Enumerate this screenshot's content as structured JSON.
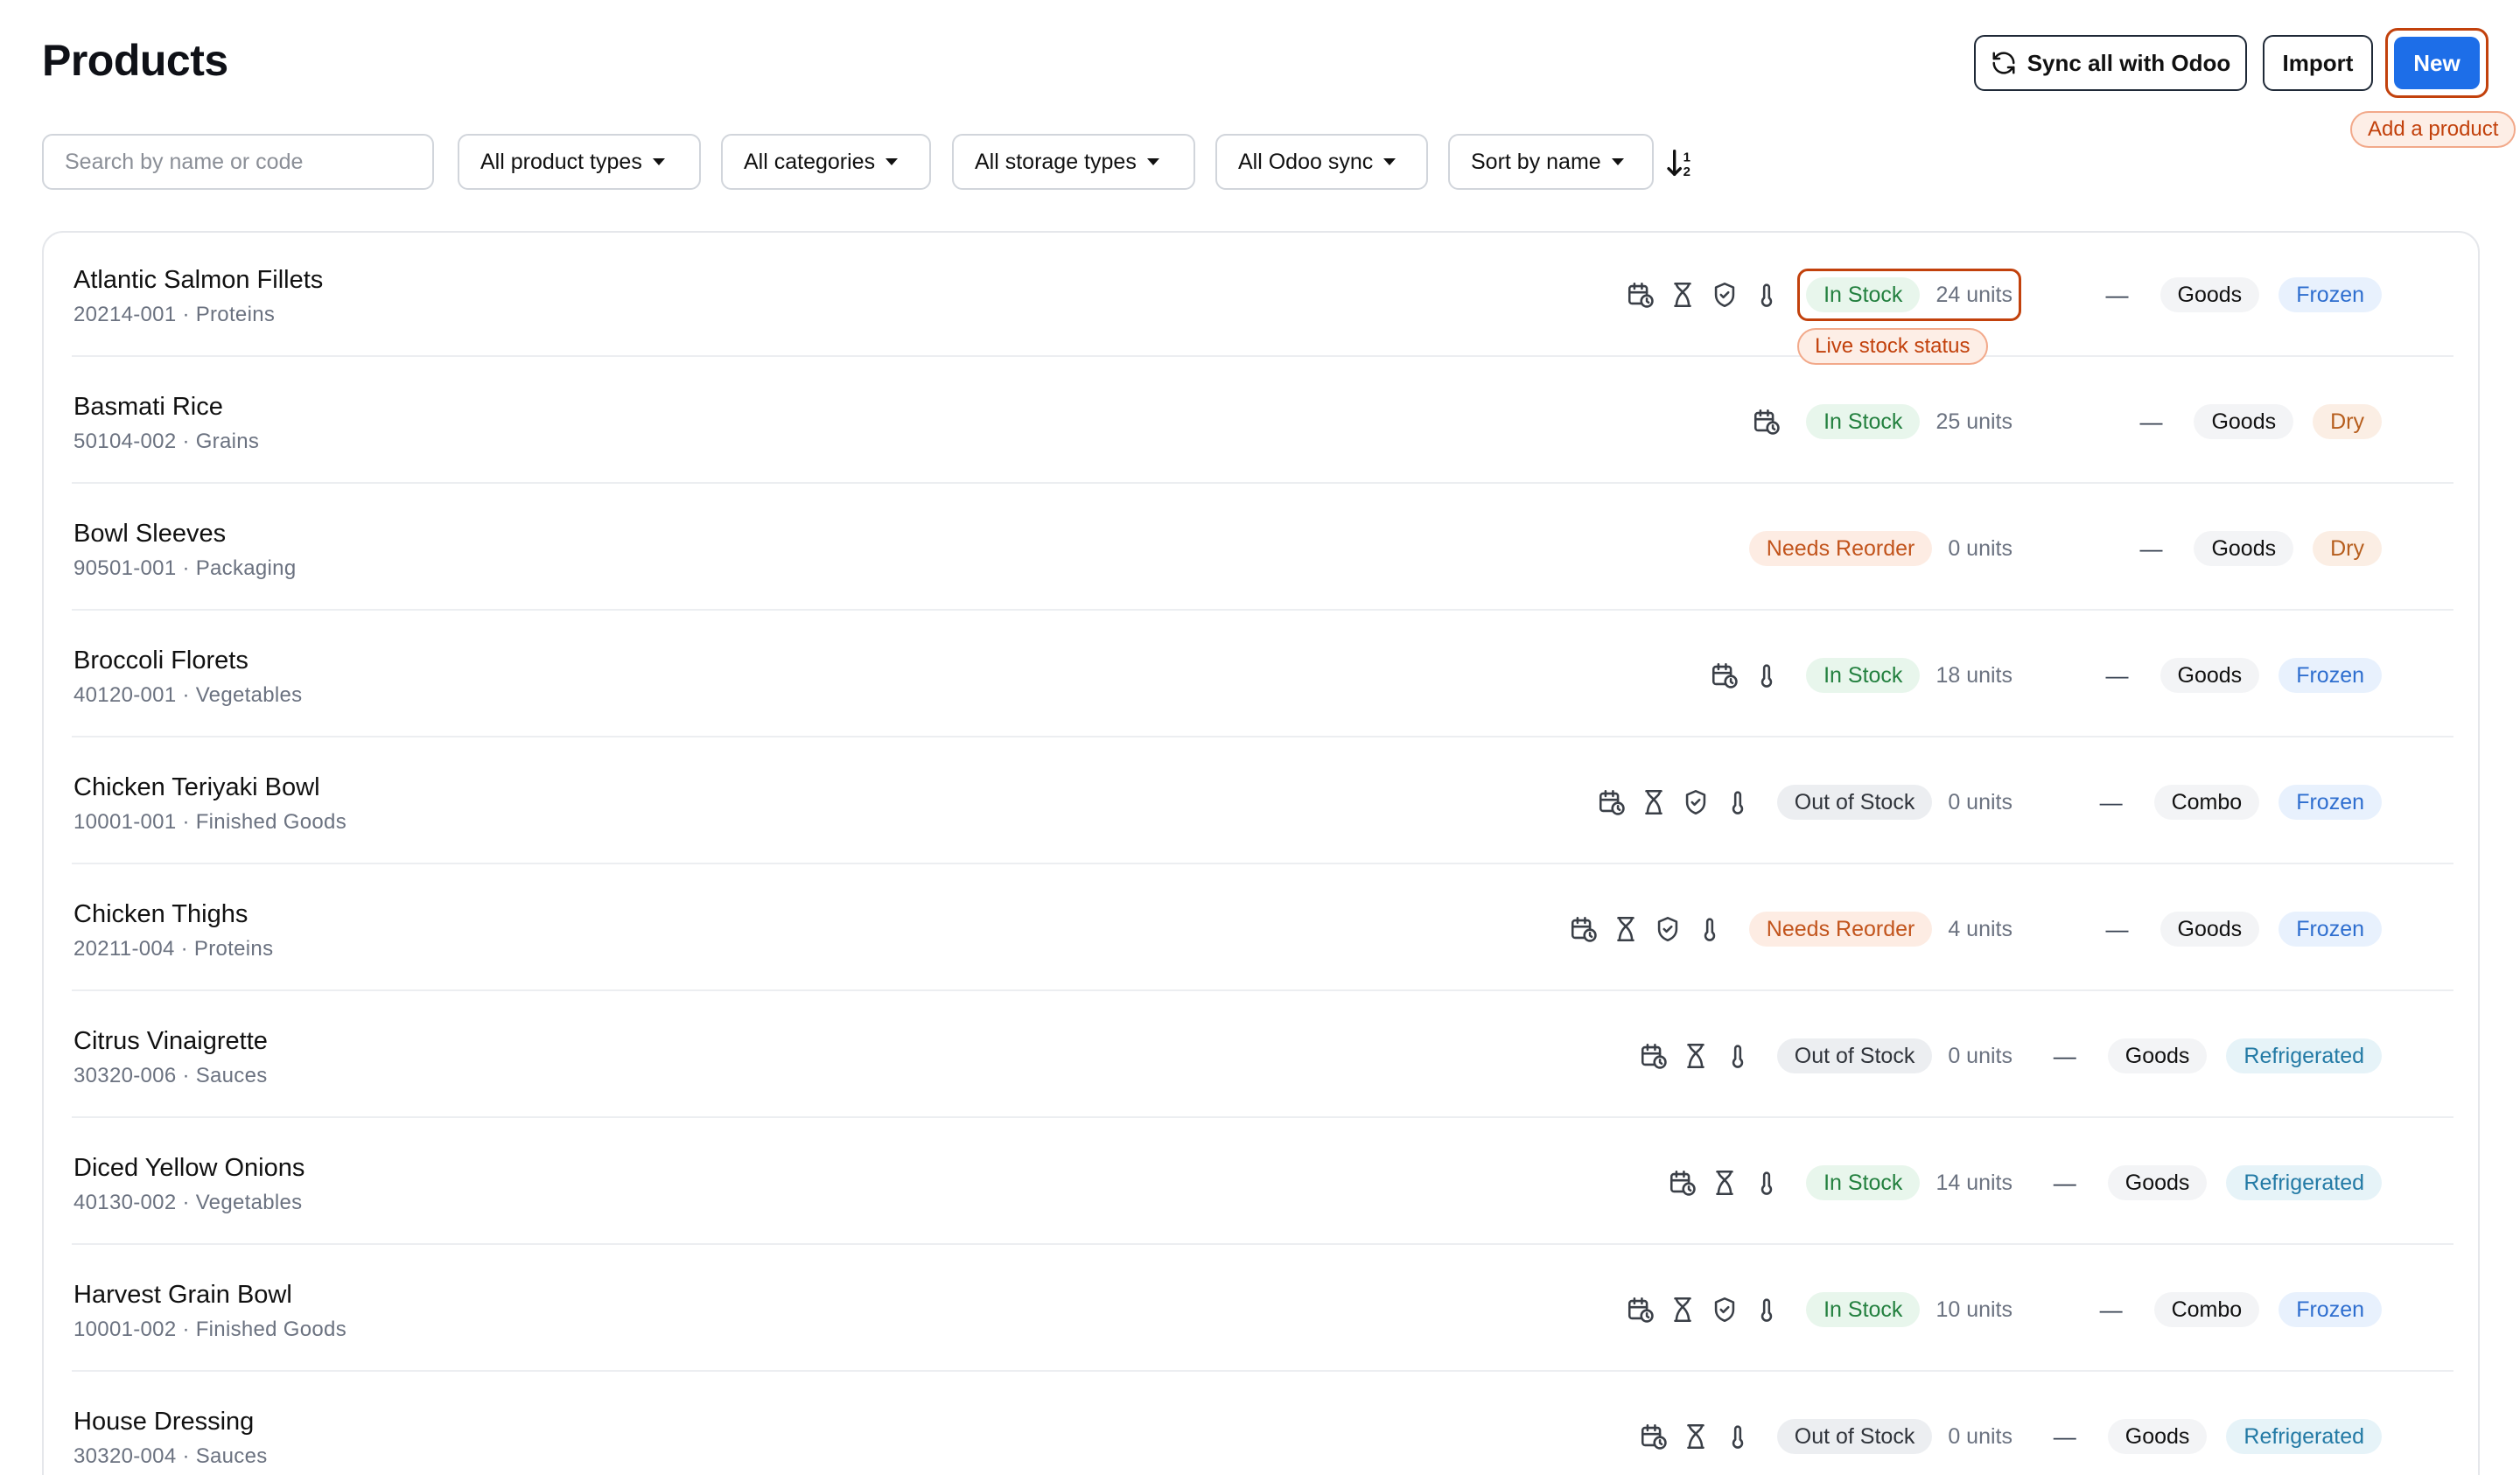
{
  "header": {
    "title": "Products",
    "sync_label": "Sync all with Odoo",
    "import_label": "Import",
    "new_label": "New",
    "new_tooltip": "Add a product"
  },
  "filters": {
    "search_placeholder": "Search by name or code",
    "product_types": "All product types",
    "categories": "All categories",
    "storage_types": "All storage types",
    "odoo_sync": "All Odoo sync",
    "sort": "Sort by name"
  },
  "stock_tooltip": "Live stock status",
  "colors": {
    "accent": "#1d6ee8",
    "highlight": "#c2410c"
  },
  "products": [
    {
      "name": "Atlantic Salmon Fillets",
      "code": "20214-001 · Proteins",
      "icons": [
        "calendar-clock",
        "hourglass",
        "shield-check",
        "thermometer"
      ],
      "status": "In Stock",
      "status_kind": "in",
      "units": "24 units",
      "type": "Goods",
      "storage": "Frozen",
      "storage_kind": "frozen",
      "dash": "—"
    },
    {
      "name": "Basmati Rice",
      "code": "50104-002 · Grains",
      "icons": [
        "calendar-clock"
      ],
      "status": "In Stock",
      "status_kind": "in",
      "units": "25 units",
      "type": "Goods",
      "storage": "Dry",
      "storage_kind": "dry",
      "dash": "—"
    },
    {
      "name": "Bowl Sleeves",
      "code": "90501-001 · Packaging",
      "icons": [],
      "status": "Needs Reorder",
      "status_kind": "re",
      "units": "0 units",
      "type": "Goods",
      "storage": "Dry",
      "storage_kind": "dry",
      "dash": "—"
    },
    {
      "name": "Broccoli Florets",
      "code": "40120-001 · Vegetables",
      "icons": [
        "calendar-clock",
        "thermometer"
      ],
      "status": "In Stock",
      "status_kind": "in",
      "units": "18 units",
      "type": "Goods",
      "storage": "Frozen",
      "storage_kind": "frozen",
      "dash": "—"
    },
    {
      "name": "Chicken Teriyaki Bowl",
      "code": "10001-001 · Finished Goods",
      "icons": [
        "calendar-clock",
        "hourglass",
        "shield-check",
        "thermometer"
      ],
      "status": "Out of Stock",
      "status_kind": "out",
      "units": "0 units",
      "type": "Combo",
      "storage": "Frozen",
      "storage_kind": "frozen",
      "dash": "—"
    },
    {
      "name": "Chicken Thighs",
      "code": "20211-004 · Proteins",
      "icons": [
        "calendar-clock",
        "hourglass",
        "shield-check",
        "thermometer"
      ],
      "status": "Needs Reorder",
      "status_kind": "re",
      "units": "4 units",
      "type": "Goods",
      "storage": "Frozen",
      "storage_kind": "frozen",
      "dash": "—"
    },
    {
      "name": "Citrus Vinaigrette",
      "code": "30320-006 · Sauces",
      "icons": [
        "calendar-clock",
        "hourglass",
        "thermometer"
      ],
      "status": "Out of Stock",
      "status_kind": "out",
      "units": "0 units",
      "type": "Goods",
      "storage": "Refrigerated",
      "storage_kind": "refrigerated",
      "dash": "—"
    },
    {
      "name": "Diced Yellow Onions",
      "code": "40130-002 · Vegetables",
      "icons": [
        "calendar-clock",
        "hourglass",
        "thermometer"
      ],
      "status": "In Stock",
      "status_kind": "in",
      "units": "14 units",
      "type": "Goods",
      "storage": "Refrigerated",
      "storage_kind": "refrigerated",
      "dash": "—"
    },
    {
      "name": "Harvest Grain Bowl",
      "code": "10001-002 · Finished Goods",
      "icons": [
        "calendar-clock",
        "hourglass",
        "shield-check",
        "thermometer"
      ],
      "status": "In Stock",
      "status_kind": "in",
      "units": "10 units",
      "type": "Combo",
      "storage": "Frozen",
      "storage_kind": "frozen",
      "dash": "—"
    },
    {
      "name": "House Dressing",
      "code": "30320-004 · Sauces",
      "icons": [
        "calendar-clock",
        "hourglass",
        "thermometer"
      ],
      "status": "Out of Stock",
      "status_kind": "out",
      "units": "0 units",
      "type": "Goods",
      "storage": "Refrigerated",
      "storage_kind": "refrigerated",
      "dash": "—"
    }
  ]
}
